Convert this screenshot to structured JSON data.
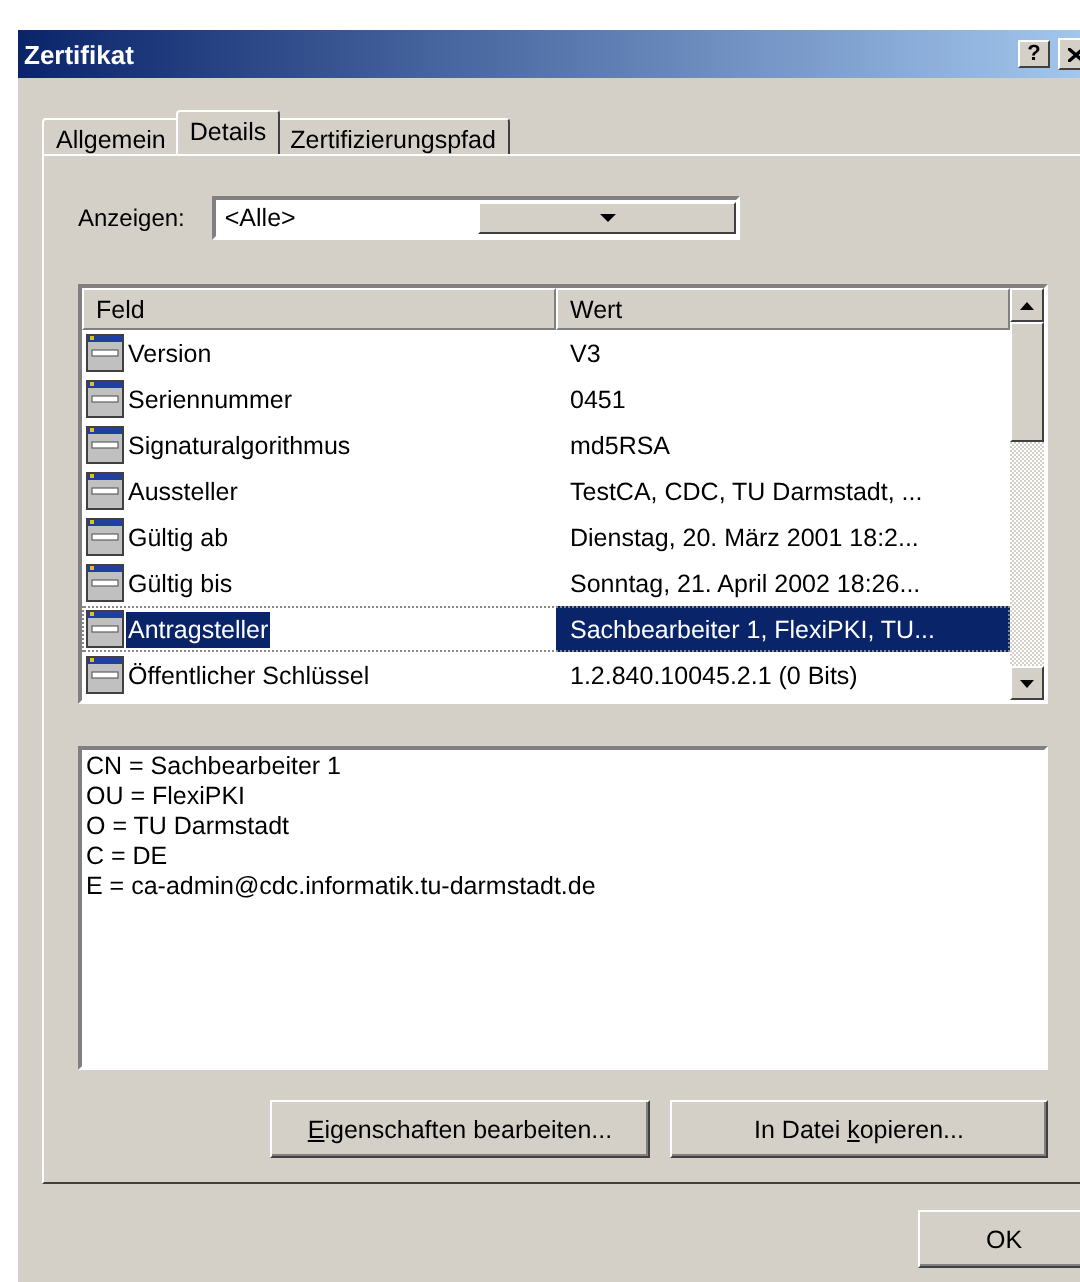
{
  "window": {
    "title": "Zertifikat",
    "help_button": "?"
  },
  "tabs": [
    {
      "label": "Allgemein",
      "selected": false
    },
    {
      "label": "Details",
      "selected": true
    },
    {
      "label": "Zertifizierungspfad",
      "selected": false
    }
  ],
  "show": {
    "label": "Anzeigen:",
    "value": "<Alle>"
  },
  "table": {
    "columns": [
      "Feld",
      "Wert"
    ],
    "rows": [
      {
        "field": "Version",
        "value": "V3",
        "selected": false
      },
      {
        "field": "Seriennummer",
        "value": "0451",
        "selected": false
      },
      {
        "field": "Signaturalgorithmus",
        "value": "md5RSA",
        "selected": false
      },
      {
        "field": "Aussteller",
        "value": "TestCA, CDC, TU Darmstadt, ...",
        "selected": false
      },
      {
        "field": "Gültig ab",
        "value": "Dienstag, 20. März 2001 18:2...",
        "selected": false
      },
      {
        "field": "Gültig bis",
        "value": "Sonntag, 21. April 2002 18:26...",
        "selected": false
      },
      {
        "field": "Antragsteller",
        "value": "Sachbearbeiter 1, FlexiPKI, TU...",
        "selected": true
      },
      {
        "field": "Öffentlicher Schlüssel",
        "value": "1.2.840.10045.2.1 (0 Bits)",
        "selected": false
      }
    ]
  },
  "detail_lines": [
    "CN = Sachbearbeiter 1",
    "OU = FlexiPKI",
    "O = TU Darmstadt",
    "C = DE",
    "E = ca-admin@cdc.informatik.tu-darmstadt.de"
  ],
  "buttons": [
    {
      "access_key": "E",
      "label_after": "igenschaften bearbeiten..."
    },
    {
      "label_before": "In Datei ",
      "access_key": "k",
      "label_after": "opieren..."
    }
  ],
  "ok_button": "OK"
}
